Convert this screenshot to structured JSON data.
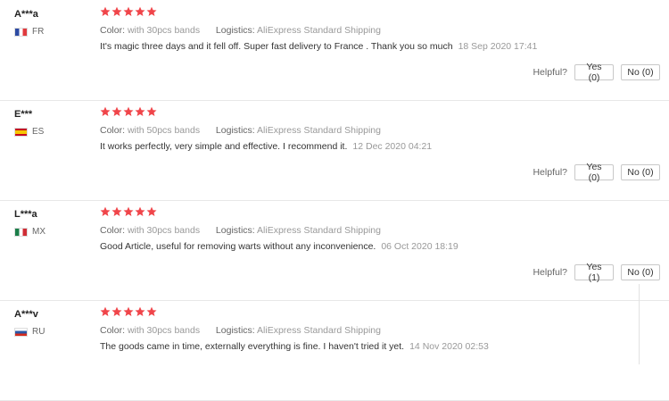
{
  "labels": {
    "color": "Color:",
    "logistics": "Logistics:",
    "helpful": "Helpful?",
    "yes": "Yes",
    "no": "No"
  },
  "colors": {
    "star": "#f0454a"
  },
  "reviews": [
    {
      "user": "A***a",
      "country": "FR",
      "flag_icon": "france-flag-icon",
      "rating": 5,
      "color_value": "with 30pcs bands",
      "logistics_value": "AliExpress Standard Shipping",
      "text": "It's magic three days and it fell off. Super fast delivery to France . Thank you so much",
      "date": "18 Sep 2020 17:41",
      "yes_label": "Yes (0)",
      "no_label": "No (0)"
    },
    {
      "user": "E***",
      "country": "ES",
      "flag_icon": "spain-flag-icon",
      "rating": 5,
      "color_value": "with 50pcs bands",
      "logistics_value": "AliExpress Standard Shipping",
      "text": "It works perfectly, very simple and effective. I recommend it.",
      "date": "12 Dec 2020 04:21",
      "yes_label": "Yes (0)",
      "no_label": "No (0)"
    },
    {
      "user": "L***a",
      "country": "MX",
      "flag_icon": "mexico-flag-icon",
      "rating": 5,
      "color_value": "with 30pcs bands",
      "logistics_value": "AliExpress Standard Shipping",
      "text": "Good Article, useful for removing warts without any inconvenience.",
      "date": "06 Oct 2020 18:19",
      "yes_label": "Yes (1)",
      "no_label": "No (0)"
    },
    {
      "user": "A***v",
      "country": "RU",
      "flag_icon": "russia-flag-icon",
      "rating": 5,
      "color_value": "with 30pcs bands",
      "logistics_value": "AliExpress Standard Shipping",
      "text": "The goods came in time, externally everything is fine. I haven't tried it yet.",
      "date": "14 Nov 2020 02:53"
    }
  ]
}
